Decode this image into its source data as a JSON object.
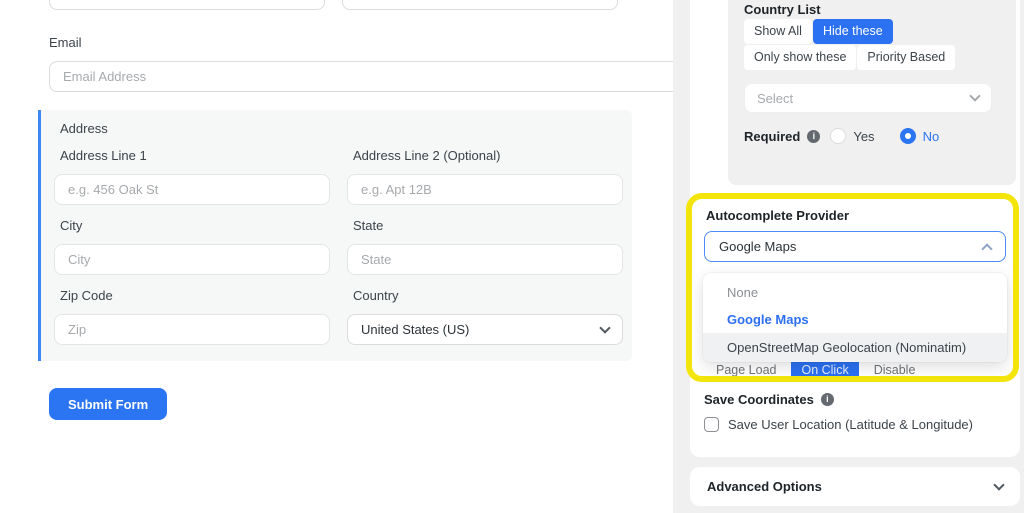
{
  "form": {
    "email": {
      "label": "Email",
      "placeholder": "Email Address"
    },
    "address": {
      "section_label": "Address",
      "line1": {
        "label": "Address Line 1",
        "placeholder": "e.g. 456 Oak St"
      },
      "line2": {
        "label": "Address Line 2 (Optional)",
        "placeholder": "e.g. Apt 12B"
      },
      "city": {
        "label": "City",
        "placeholder": "City"
      },
      "state": {
        "label": "State",
        "placeholder": "State"
      },
      "zip": {
        "label": "Zip Code",
        "placeholder": "Zip"
      },
      "country": {
        "label": "Country",
        "value": "United States (US)"
      }
    },
    "submit_label": "Submit Form"
  },
  "settings": {
    "country_list": {
      "label": "Country List",
      "modes": [
        "Show All",
        "Hide these",
        "Only show these",
        "Priority Based"
      ],
      "selected_mode": "Hide these",
      "select_placeholder": "Select",
      "required": {
        "label": "Required",
        "yes": "Yes",
        "no": "No",
        "selected": "No"
      }
    },
    "autocomplete": {
      "label": "Autocomplete Provider",
      "value": "Google Maps",
      "options": [
        "None",
        "Google Maps",
        "OpenStreetMap Geolocation (Nominatim)"
      ],
      "selected_option": "Google Maps",
      "highlighted_option": "OpenStreetMap Geolocation (Nominatim)"
    },
    "trigger": {
      "modes": [
        "Page Load",
        "On Click",
        "Disable"
      ],
      "selected": "On Click"
    },
    "save_coordinates": {
      "label": "Save Coordinates",
      "checkbox_label": "Save User Location (Latitude & Longitude)",
      "checked": false
    },
    "advanced": {
      "label": "Advanced Options"
    }
  },
  "colors": {
    "accent_blue": "#2b71f2",
    "link_blue": "#2d6ff2",
    "highlight_yellow": "#f3e50b",
    "panel_gray": "#f0f0f1"
  }
}
